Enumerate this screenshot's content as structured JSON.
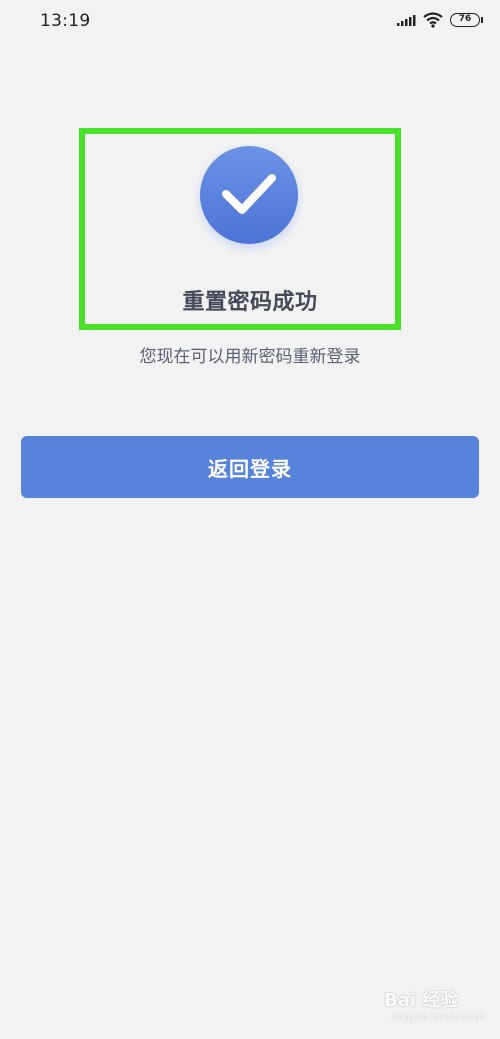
{
  "status_bar": {
    "time": "13:19",
    "battery": "76"
  },
  "result": {
    "title": "重置密码成功",
    "subtitle": "您现在可以用新密码重新登录"
  },
  "actions": {
    "back_to_login": "返回登录"
  },
  "watermark": {
    "main": "Bai 经验",
    "sub": "jingyan.baidu.com"
  },
  "colors": {
    "background": "#f2f2f2",
    "accent": "#5784da",
    "highlight": "#49e02a"
  }
}
